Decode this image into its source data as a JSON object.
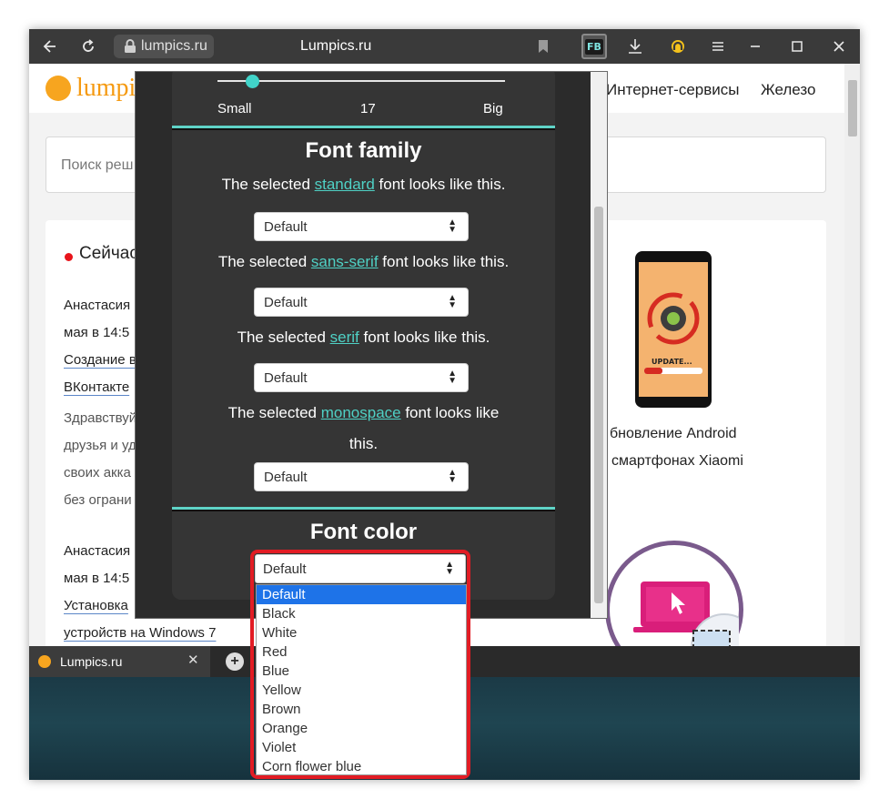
{
  "browser": {
    "address": "lumpics.ru",
    "title": "Lumpics.ru",
    "extension_label": "FB"
  },
  "site": {
    "logo_text": "lumpi",
    "nav": [
      "Интернет-сервисы",
      "Железо"
    ],
    "search_placeholder": "Поиск реш",
    "live_title": "Сейчас",
    "feed": [
      {
        "text": "Анастасия",
        "style": "normal"
      },
      {
        "text": "мая в 14:5",
        "style": "normal"
      },
      {
        "text": "Создание в",
        "style": "link"
      },
      {
        "text": "ВКонтакте",
        "style": "link"
      },
      {
        "text": "Здравствуй",
        "style": "gray"
      },
      {
        "text": "друзья и уд",
        "style": "gray"
      },
      {
        "text": "своих акка",
        "style": "gray"
      },
      {
        "text": "без ограни",
        "style": "gray"
      },
      {
        "text": "Анастасия",
        "style": "normal"
      },
      {
        "text": "мая в 14:5",
        "style": "normal"
      },
      {
        "text": "Установка",
        "style": "link"
      },
      {
        "text": "устройств на Windows 7",
        "style": "link"
      }
    ],
    "caption_line1": "бновление Android",
    "caption_line2": "смартфонах Xiaomi",
    "phone_update_label": "UPDATE..."
  },
  "tab": {
    "label": "Lumpics.ru"
  },
  "popup": {
    "slider": {
      "min_label": "Small",
      "value": "17",
      "max_label": "Big",
      "fraction": 0.12
    },
    "font_family_title": "Font family",
    "font_rows": [
      {
        "prefix": "The selected ",
        "link": "standard",
        "suffix": " font looks like this.",
        "value": "Default"
      },
      {
        "prefix": "The selected ",
        "link": "sans-serif",
        "suffix": " font looks like this.",
        "value": "Default"
      },
      {
        "prefix": "The selected ",
        "link": "serif",
        "suffix": " font looks like this.",
        "value": "Default"
      },
      {
        "prefix": "The selected ",
        "link": "monospace",
        "suffix": " font looks like",
        "suffix2": "this.",
        "value": "Default"
      }
    ],
    "font_color_title": "Font color",
    "font_color_value": "Default",
    "color_options": [
      "Default",
      "Black",
      "White",
      "Red",
      "Blue",
      "Yellow",
      "Brown",
      "Orange",
      "Violet",
      "Corn flower blue"
    ],
    "color_selected_index": 0
  },
  "colors": {
    "accent_teal": "#4fd1c5",
    "highlight_red": "#e21c24",
    "selection_blue": "#1e73e8",
    "popup_bg": "#2b2b2b",
    "brand_orange": "#f59a11"
  }
}
